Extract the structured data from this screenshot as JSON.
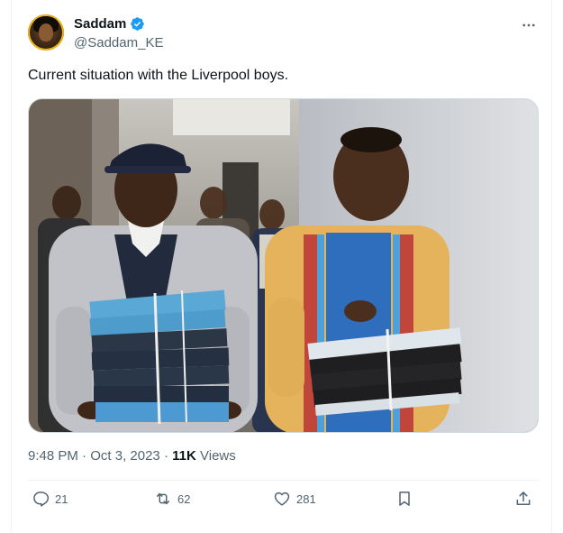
{
  "tweet": {
    "display_name": "Saddam",
    "handle": "@Saddam_KE",
    "verified": true,
    "text": "Current situation with the Liverpool boys.",
    "time": "9:48 PM",
    "separator": "·",
    "date": "Oct 3, 2023",
    "views_count": "11K",
    "views_label": "Views"
  },
  "actions": {
    "replies": "21",
    "reposts": "62",
    "likes": "281"
  },
  "colors": {
    "text_primary": "#0f1419",
    "text_secondary": "#536471",
    "verified_blue": "#1d9bf0",
    "border": "#cfd9de"
  },
  "icons": {
    "verified": "verified-badge-icon",
    "more": "more-horizontal-icon",
    "reply": "reply-icon",
    "repost": "repost-icon",
    "like": "heart-icon",
    "bookmark": "bookmark-icon",
    "share": "share-icon"
  }
}
